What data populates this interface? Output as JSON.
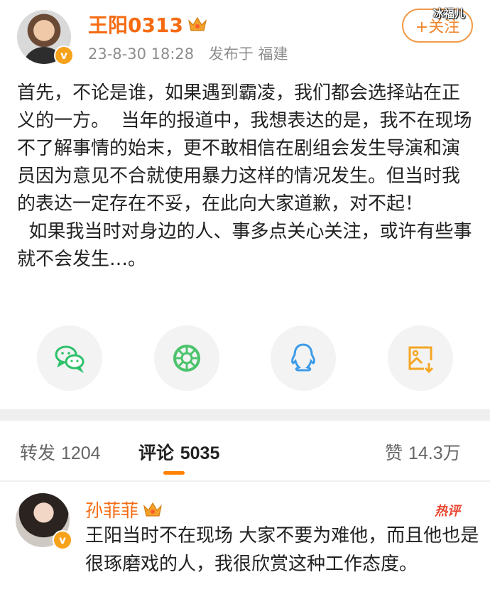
{
  "post": {
    "username": "王阳0313",
    "timestamp": "23-8-30 18:28",
    "location": "发布于 福建",
    "follow_label": "+关注",
    "watermark": "冰福儿",
    "text": "首先，不论是谁，如果遇到霸凌，我们都会选择站在正义的一方。  当年的报道中，我想表达的是，我不在现场不了解事情的始末，更不敢相信在剧组会发生导演和演员因为意见不合就使用暴力这样的情况发生。但当时我的表达一定存在不妥，在此向大家道歉，对不起！\n  如果我当时对身边的人、事多点关心关注，或许有些事就不会发生…。"
  },
  "share": [
    {
      "icon": "wechat-icon"
    },
    {
      "icon": "moments-icon"
    },
    {
      "icon": "qq-icon"
    },
    {
      "icon": "save-image-icon"
    }
  ],
  "tabs": {
    "repost_label": "转发",
    "repost_count": "1204",
    "comment_label": "评论",
    "comment_count": "5035",
    "like_label": "赞",
    "like_count": "14.3万"
  },
  "comment": {
    "username": "孙菲菲",
    "hot_label": "热评",
    "text": "王阳当时不在现场 大家不要为难他，而且他也是很琢磨戏的人，我很欣赏这种工作态度。"
  },
  "colors": {
    "accent": "#f66b12",
    "tab_underline": "#ff8200",
    "wechat": "#2dc16b",
    "moments": "#4cc36d",
    "qq": "#3c9be8",
    "save": "#f5a623"
  }
}
